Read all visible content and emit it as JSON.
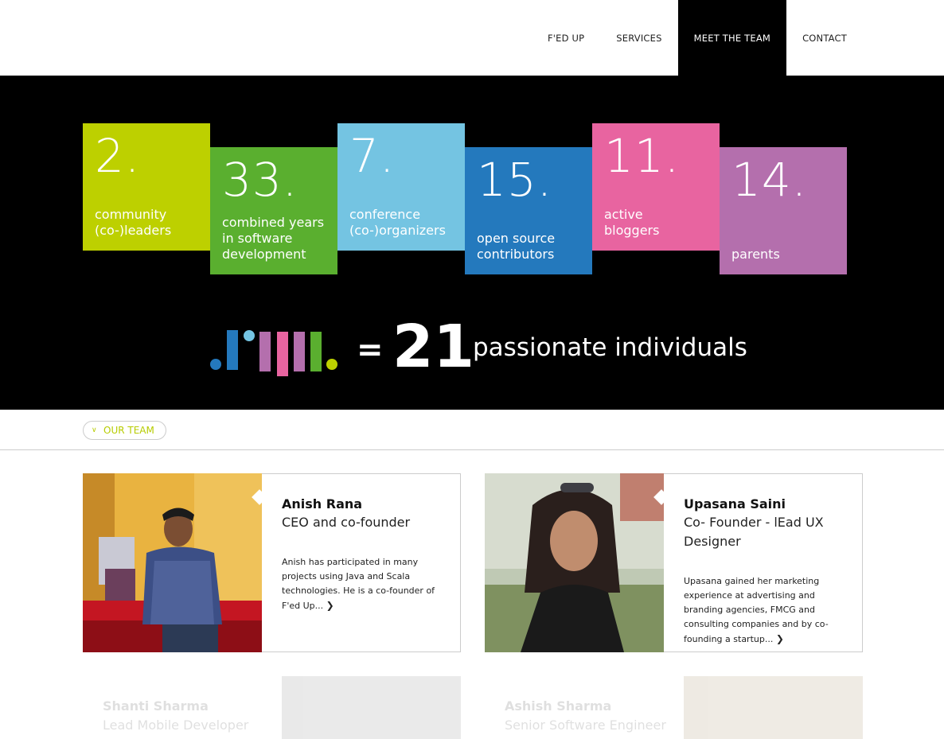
{
  "nav": {
    "items": [
      "F'ED UP",
      "SERVICES",
      "MEET THE TEAM",
      "CONTACT"
    ],
    "active": "MEET THE TEAM"
  },
  "stats": [
    {
      "number": "2.",
      "label": "community\n(co-)leaders",
      "color": "#bdd000"
    },
    {
      "number": "33.",
      "label": "combined years\nin software\ndevelopment",
      "color": "#5aaf2f"
    },
    {
      "number": "7.",
      "label": "conference\n(co-)organizers",
      "color": "#74c4e2"
    },
    {
      "number": "15.",
      "label": "open source\ncontributors",
      "color": "#2479bd"
    },
    {
      "number": "11.",
      "label": "active\nbloggers",
      "color": "#e864a0"
    },
    {
      "number": "14.",
      "label": "parents",
      "color": "#b46fad"
    }
  ],
  "summary": {
    "equals": "=",
    "count": "21",
    "text": "passionate individuals"
  },
  "section": {
    "label": "OUR TEAM"
  },
  "team": [
    {
      "name": "Anish Rana",
      "role": "CEO and co-founder",
      "bio": "Anish has participated in many projects using Java and Scala technologies. He is a co-founder of F'ed Up...",
      "more": "❯"
    },
    {
      "name": "Upasana Saini",
      "role": "Co- Founder - lEad UX Designer",
      "bio": "Upasana gained her marketing experience at advertising and branding agencies, FMCG and consulting companies and by co-founding a startup...",
      "more": "❯"
    },
    {
      "name": "Shanti Sharma",
      "role": "Lead Mobile Developer"
    },
    {
      "name": "Ashish Sharma",
      "role": "Senior Software Engineer"
    }
  ]
}
